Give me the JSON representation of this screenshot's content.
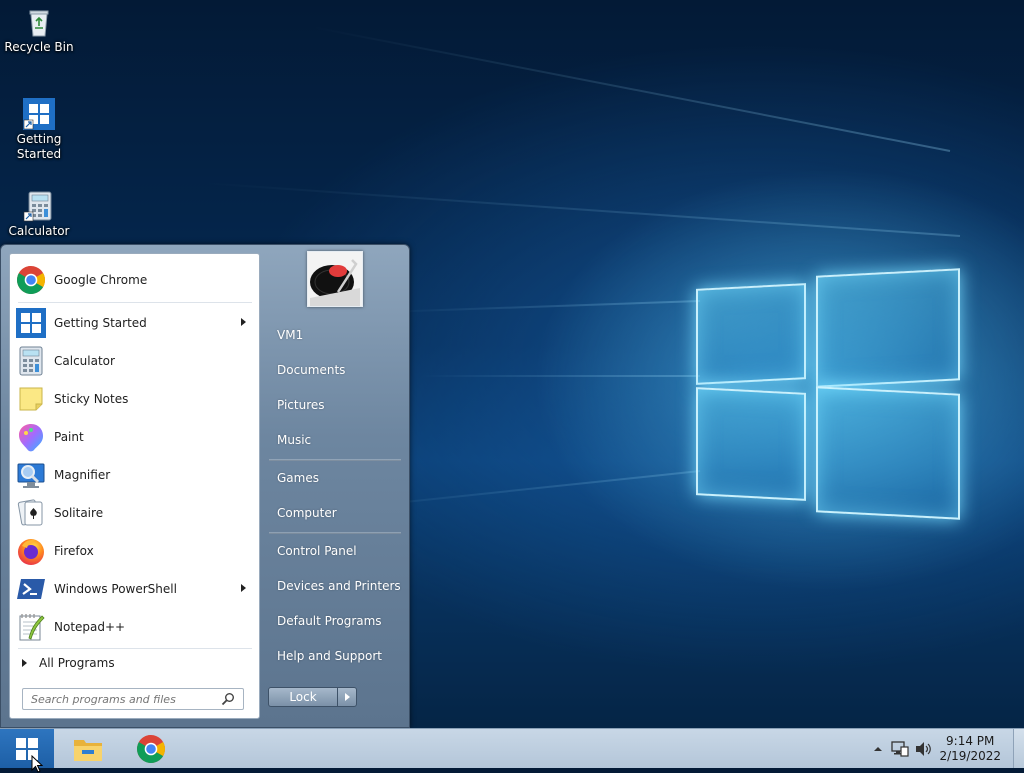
{
  "desktop": {
    "icons": [
      {
        "label": "Recycle Bin",
        "icon": "recycle-bin-icon"
      },
      {
        "label": "Getting\nStarted",
        "label_line1": "Getting",
        "label_line2": "Started",
        "icon": "windows-logo-icon"
      },
      {
        "label": "Calculator",
        "icon": "calculator-icon"
      }
    ]
  },
  "start_menu": {
    "programs": [
      {
        "label": "Google Chrome",
        "icon": "chrome-icon",
        "submenu": false
      },
      {
        "label": "Getting Started",
        "icon": "windows-logo-icon",
        "submenu": true
      },
      {
        "label": "Calculator",
        "icon": "calculator-icon",
        "submenu": false
      },
      {
        "label": "Sticky Notes",
        "icon": "sticky-notes-icon",
        "submenu": false
      },
      {
        "label": "Paint",
        "icon": "paint-icon",
        "submenu": false
      },
      {
        "label": "Magnifier",
        "icon": "magnifier-icon",
        "submenu": false
      },
      {
        "label": "Solitaire",
        "icon": "solitaire-icon",
        "submenu": false
      },
      {
        "label": "Firefox",
        "icon": "firefox-icon",
        "submenu": false
      },
      {
        "label": "Windows PowerShell",
        "icon": "powershell-icon",
        "submenu": true
      },
      {
        "label": "Notepad++",
        "icon": "notepad-plus-plus-icon",
        "submenu": false
      }
    ],
    "all_programs": "All Programs",
    "search_placeholder": "Search programs and files",
    "right_items": [
      {
        "label": "VM1"
      },
      {
        "label": "Documents"
      },
      {
        "label": "Pictures"
      },
      {
        "label": "Music"
      },
      {
        "label": "Games"
      },
      {
        "label": "Computer"
      },
      {
        "label": "Control Panel"
      },
      {
        "label": "Devices and Printers"
      },
      {
        "label": "Default Programs"
      },
      {
        "label": "Help and Support"
      }
    ],
    "lock_label": "Lock"
  },
  "taskbar": {
    "apps": [
      {
        "icon": "file-explorer-icon"
      },
      {
        "icon": "chrome-icon"
      }
    ],
    "time": "9:14 PM",
    "date": "2/19/2022"
  }
}
